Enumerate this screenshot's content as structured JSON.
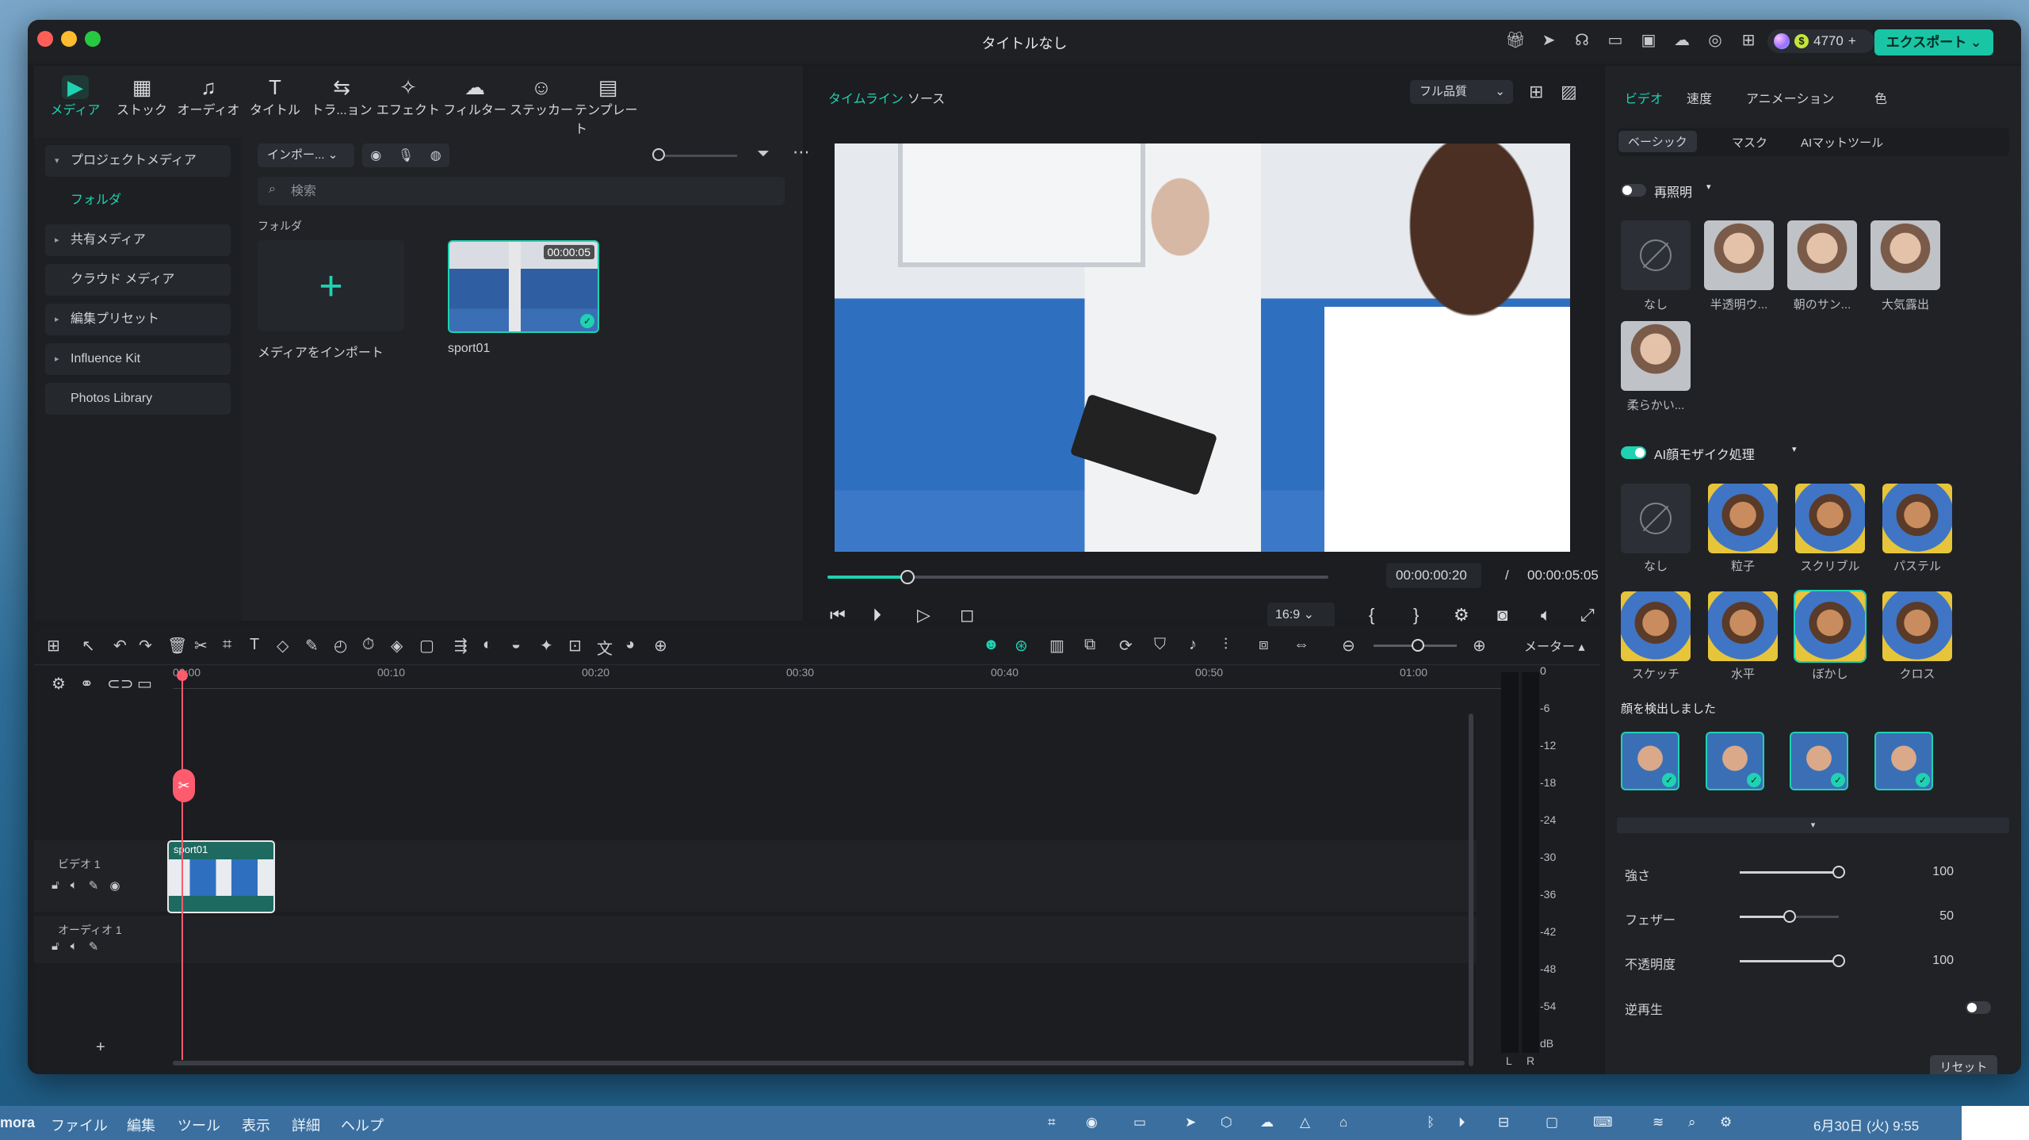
{
  "window": {
    "title": "タイトルなし",
    "credits": "4770",
    "export_label": "エクスポート"
  },
  "title_icons": [
    "gift-icon",
    "send-icon",
    "headset-icon",
    "layout-icon",
    "save-icon",
    "cloud-upload-icon",
    "support-icon",
    "apps-icon"
  ],
  "media_tabs": [
    {
      "label": "メディア",
      "icon": "▶"
    },
    {
      "label": "ストック",
      "icon": "▦"
    },
    {
      "label": "オーディオ",
      "icon": "♫"
    },
    {
      "label": "タイトル",
      "icon": "T"
    },
    {
      "label": "トラ...ョン",
      "icon": "⇆"
    },
    {
      "label": "エフェクト",
      "icon": "✧"
    },
    {
      "label": "フィルター",
      "icon": "☁"
    },
    {
      "label": "ステッカー",
      "icon": "☺"
    },
    {
      "label": "テンプレート",
      "icon": "▤"
    }
  ],
  "sidebar": {
    "items": [
      {
        "label": "プロジェクトメディア",
        "caret": "▾"
      },
      {
        "label": "フォルダ",
        "caret": ""
      },
      {
        "label": "共有メディア",
        "caret": "▸"
      },
      {
        "label": "クラウド メディア",
        "caret": ""
      },
      {
        "label": "編集プリセット",
        "caret": "▸"
      },
      {
        "label": "Influence Kit",
        "caret": "▸"
      },
      {
        "label": "Photos Library",
        "caret": ""
      }
    ]
  },
  "media": {
    "import_label": "インポー...",
    "search_placeholder": "検索",
    "folder_label": "フォルダ",
    "import_tile_caption": "メディアをインポート",
    "clip_name": "sport01",
    "clip_duration": "00:00:05"
  },
  "preview": {
    "tab_timeline": "タイムライン",
    "tab_source": "ソース",
    "quality": "フル品質",
    "current_time": "00:00:00:20",
    "separator": "/",
    "total_time": "00:00:05:05",
    "aspect": "16:9",
    "progress": 0.16
  },
  "props": {
    "tabs": [
      "ビデオ",
      "速度",
      "アニメーション",
      "色"
    ],
    "subtabs": [
      "ベーシック",
      "マスク",
      "AIマットツール"
    ],
    "relight_label": "再照明",
    "relight_presets": [
      "なし",
      "半透明ウ...",
      "朝のサン...",
      "大気露出",
      "柔らかい..."
    ],
    "mosaic_label": "AI顔モザイク処理",
    "mosaic_presets": [
      "なし",
      "粒子",
      "スクリブル",
      "パステル",
      "スケッチ",
      "水平",
      "ぼかし",
      "クロス"
    ],
    "faces_label": "顔を検出しました",
    "params": [
      {
        "label": "強さ",
        "value": "100",
        "level": 1.0
      },
      {
        "label": "フェザー",
        "value": "50",
        "level": 0.5
      },
      {
        "label": "不透明度",
        "value": "100",
        "level": 1.0
      }
    ],
    "reverse_label": "逆再生",
    "reset_label": "リセット"
  },
  "timeline": {
    "ticks": [
      "00:00",
      "00:10",
      "00:20",
      "00:30",
      "00:40",
      "00:50",
      "01:00"
    ],
    "meter_label": "メーター",
    "video_track": "ビデオ 1",
    "audio_track": "オーディオ 1",
    "clip_label": "sport01",
    "vu_scale": [
      "0",
      "-6",
      "-12",
      "-18",
      "-24",
      "-30",
      "-36",
      "-42",
      "-48",
      "-54",
      "dB"
    ],
    "vu_channels": [
      "L",
      "R"
    ]
  },
  "menubar": {
    "app": "mora",
    "items": [
      "ファイル",
      "編集",
      "ツール",
      "表示",
      "詳細",
      "ヘルプ"
    ],
    "clock": "6月30日 (火) 9:55"
  }
}
